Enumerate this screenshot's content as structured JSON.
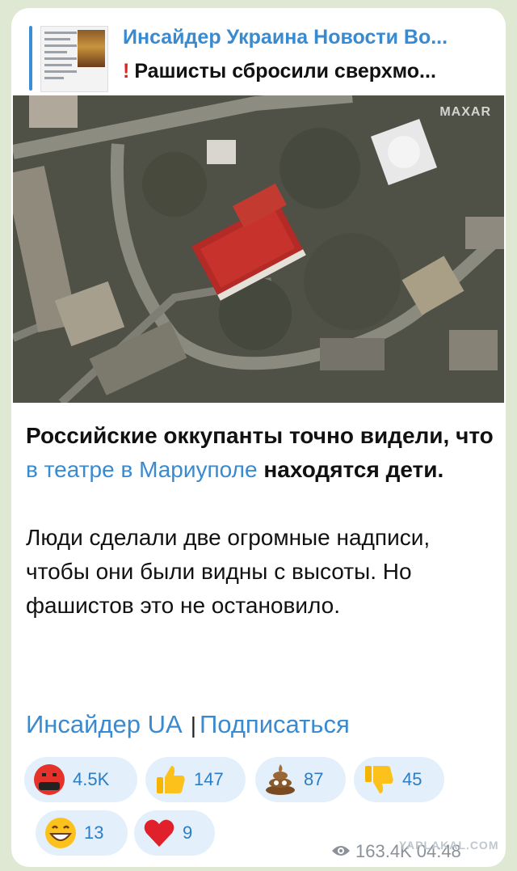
{
  "reply": {
    "channel_title": "Инсайдер Украина Новости Во...",
    "quoted_text": "Рашисты сбросили сверхмо...",
    "exclaim_icon": "exclamation-icon"
  },
  "photo": {
    "watermark": "MAXAR"
  },
  "message": {
    "p1_bold_a": "Российские оккупанты точно видели, что ",
    "p1_link": "в театре в Мариуполе",
    "p1_bold_b": " находятся дети.",
    "p2": "Люди сделали две огромные надписи, чтобы они были видны с высоты. Но фашистов это не остановило."
  },
  "links": {
    "channel": "Инсайдер UA",
    "separator": "|",
    "subscribe": "Подписаться"
  },
  "reactions": [
    {
      "icon": "angry-face-icon",
      "count": "4.5K"
    },
    {
      "icon": "thumbs-up-icon",
      "count": "147"
    },
    {
      "icon": "poop-icon",
      "count": "87"
    },
    {
      "icon": "thumbs-down-icon",
      "count": "45"
    },
    {
      "icon": "grin-face-icon",
      "count": "13"
    },
    {
      "icon": "heart-icon",
      "count": "9"
    }
  ],
  "meta": {
    "views": "163.4K",
    "time": "04:48",
    "watermark": "YAPLAKAL.COM"
  },
  "colors": {
    "link": "#3a8ad0",
    "reaction_bg": "#e3f0fb",
    "background": "#dfe8d3"
  }
}
